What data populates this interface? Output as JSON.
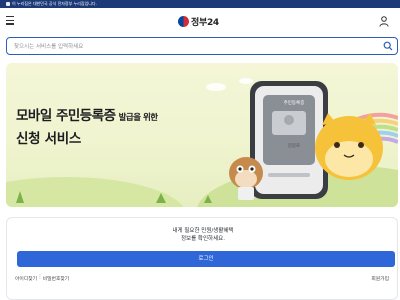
{
  "gov_bar": {
    "notice": "이 누리집은 대한민국 공식 전자정부 누리집입니다."
  },
  "header": {
    "logo_text": "정부24",
    "menu_icon": "hamburger-menu-icon",
    "user_icon": "user-icon"
  },
  "search": {
    "placeholder": "찾으시는 서비스를 입력하세요",
    "icon": "search-icon"
  },
  "banner": {
    "headline_main": "모바일 주민등록증",
    "headline_suffix": "발급을 위한",
    "headline_line2": "신청 서비스",
    "phone_card_title": "주민등록증",
    "phone_card_name": "김몽로"
  },
  "login": {
    "message_line1": "내게 필요한 민원/생활혜택",
    "message_line2": "정보를 확인하세요.",
    "button_label": "로그인",
    "find_id": "아이디찾기",
    "separator": "|",
    "find_password": "비밀번호찾기",
    "signup": "회원가입"
  },
  "colors": {
    "accent": "#2f67d8",
    "gov_bar": "#1d3a78",
    "banner_bg": "#f4f6d7"
  }
}
